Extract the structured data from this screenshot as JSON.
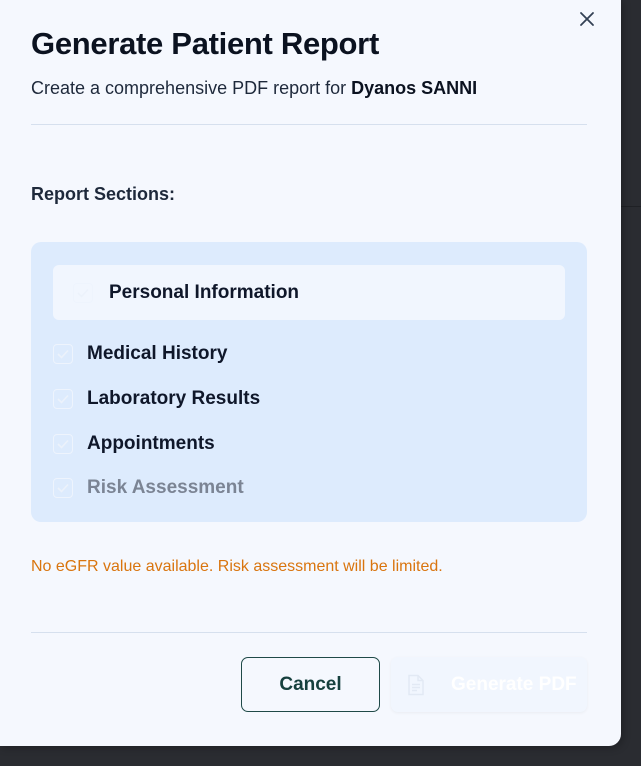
{
  "dialog": {
    "title": "Generate Patient Report",
    "subtitle_prefix": "Create a comprehensive PDF report for",
    "patient_name": "Dyanos SANNI",
    "close_icon": "close-icon"
  },
  "sections": {
    "label": "Report Sections:",
    "items": [
      {
        "label": "Personal Information",
        "checked": true,
        "highlighted": true
      },
      {
        "label": "Medical History",
        "checked": true
      },
      {
        "label": "Laboratory Results",
        "checked": true
      },
      {
        "label": "Appointments",
        "checked": true
      },
      {
        "label": "Risk Assessment",
        "checked": true,
        "disabled": true
      }
    ]
  },
  "warning": "No eGFR value available. Risk assessment will be limited.",
  "footer": {
    "cancel_label": "Cancel",
    "generate_label": "Generate PDF",
    "generate_icon": "file-text-icon",
    "generate_disabled": true
  },
  "colors": {
    "dialog_bg": "#f5f8fe",
    "sections_bg": "#ddebfd",
    "warning": "#d9750f",
    "cancel_border": "#1f4a48"
  }
}
